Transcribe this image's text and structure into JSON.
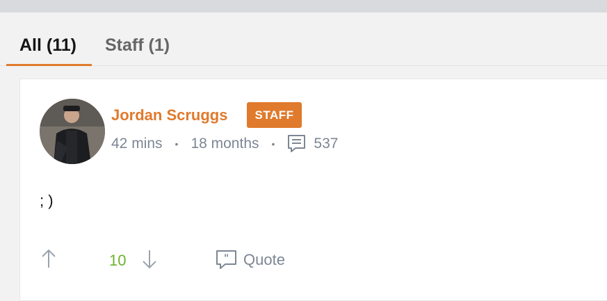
{
  "tabs": [
    {
      "label": "All (11)",
      "active": true
    },
    {
      "label": "Staff (1)",
      "active": false
    }
  ],
  "comment": {
    "author": "Jordan Scruggs",
    "badge": "STAFF",
    "posted": "42 mins",
    "member_since": "18 months",
    "post_count": "537",
    "body": "; )",
    "score": "10",
    "quote_label": "Quote"
  },
  "colors": {
    "accent": "#e07a2c",
    "score_green": "#6bb32b",
    "meta_gray": "#7c8794"
  },
  "icons": [
    "comment-count-icon",
    "upvote-arrow-icon",
    "downvote-arrow-icon",
    "quote-icon"
  ]
}
